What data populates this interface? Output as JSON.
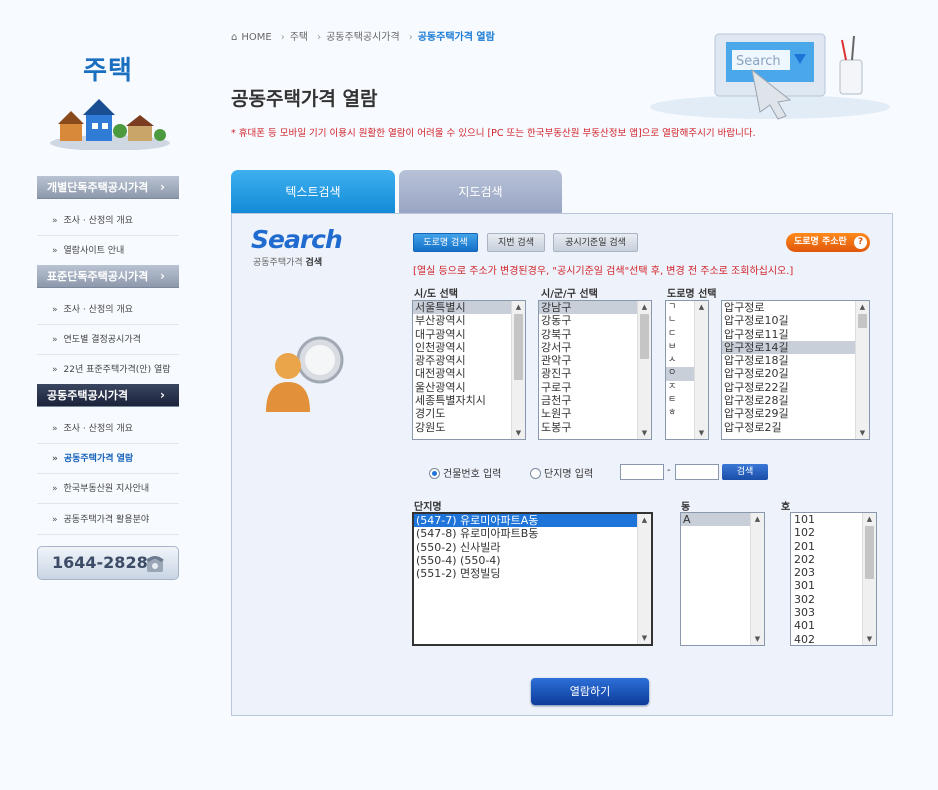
{
  "sidebar": {
    "title": "주택",
    "menu": [
      {
        "type": "head",
        "label": "개별단독주택공시가격",
        "chev": "›"
      },
      {
        "type": "item",
        "label": "조사 · 산정의 개요"
      },
      {
        "type": "item",
        "label": "열람사이트 안내"
      },
      {
        "type": "head",
        "label": "표준단독주택공시가격",
        "chev": "›"
      },
      {
        "type": "item",
        "label": "조사 · 산정의 개요"
      },
      {
        "type": "item",
        "label": "연도별 결정공시가격"
      },
      {
        "type": "item",
        "label": "22년 표준주택가격(안) 열람"
      },
      {
        "type": "head",
        "label": "공동주택공시가격",
        "chev": "›",
        "active": true
      },
      {
        "type": "item",
        "label": "조사 · 산정의 개요"
      },
      {
        "type": "item",
        "label": "공동주택가격 열람",
        "current": true
      },
      {
        "type": "item",
        "label": "한국부동산원 지사안내"
      },
      {
        "type": "item",
        "label": "공동주택가격 활용분야"
      }
    ],
    "phone": "1644-2828"
  },
  "breadcrumb": {
    "home": "HOME",
    "items": [
      "주택",
      "공동주택공시가격"
    ],
    "current": "공동주택가격 열람"
  },
  "page_title": "공동주택가격 열람",
  "notice": "* 휴대폰 등 모바일 기기 이용시 원활한 열람이 어려울 수 있으니 [PC 또는 한국부동산원 부동산정보 앱]으로 열람해주시기 바랍니다.",
  "hero_search_text": "Search",
  "tabs": [
    {
      "label": "텍스트검색",
      "active": true
    },
    {
      "label": "지도검색",
      "active": false
    }
  ],
  "search_logo": "Search",
  "search_sub_1": "공동주택가격 ",
  "search_sub_2": "검색",
  "mode_buttons": {
    "road": "도로명 검색",
    "lot": "지번 검색",
    "base_date": "공시기준일 검색",
    "road_addr": "도로명 주소란",
    "help": "?"
  },
  "warning": "[열실 등으로 주소가 변경된경우, \"공시기준일 검색\"선택 후, 변경 전 주소로 조회하십시오.]",
  "labels": {
    "sido": "시/도 선택",
    "sigungu": "시/군/구 선택",
    "road": "도로명 선택",
    "complex": "단지명",
    "dong": "동",
    "ho": "호"
  },
  "sido_options": [
    "서울특별시",
    "부산광역시",
    "대구광역시",
    "인천광역시",
    "광주광역시",
    "대전광역시",
    "울산광역시",
    "세종특별자치시",
    "경기도",
    "강원도"
  ],
  "sido_selected": "서울특별시",
  "sigungu_options": [
    "강남구",
    "강동구",
    "강북구",
    "강서구",
    "관악구",
    "광진구",
    "구로구",
    "금천구",
    "노원구",
    "도봉구"
  ],
  "sigungu_selected": "강남구",
  "initials": [
    "ㄱ",
    "ㄴ",
    "ㄷ",
    "ㅂ",
    "ㅅ",
    "ㅇ",
    "ㅈ",
    "ㅌ",
    "ㅎ"
  ],
  "initial_selected": "ㅇ",
  "road_options": [
    "압구정로",
    "압구정로10길",
    "압구정로11길",
    "압구정로14길",
    "압구정로18길",
    "압구정로20길",
    "압구정로22길",
    "압구정로28길",
    "압구정로29길",
    "압구정로2길"
  ],
  "road_selected": "압구정로14길",
  "radios": {
    "building": "건물번호 입력",
    "complex": "단지명 입력",
    "selected": "building"
  },
  "number_sep": "-",
  "search_btn": "검색",
  "complex_options": [
    "(547-7) 유로미아파트A동",
    "(547-8) 유로미아파트B동",
    "(550-2) 신사빌라",
    "(550-4) (550-4)",
    "(551-2) 면정빌딩"
  ],
  "complex_selected": "(547-7) 유로미아파트A동",
  "dong_options": [
    "A"
  ],
  "ho_options": [
    "101",
    "102",
    "201",
    "202",
    "203",
    "301",
    "302",
    "303",
    "401",
    "402"
  ],
  "view_btn": "열람하기",
  "colors": {
    "accent": "#1e74d8",
    "notice": "#d1232a",
    "tab_active": "#1089d6",
    "sidebar_active": "#1b233a"
  }
}
